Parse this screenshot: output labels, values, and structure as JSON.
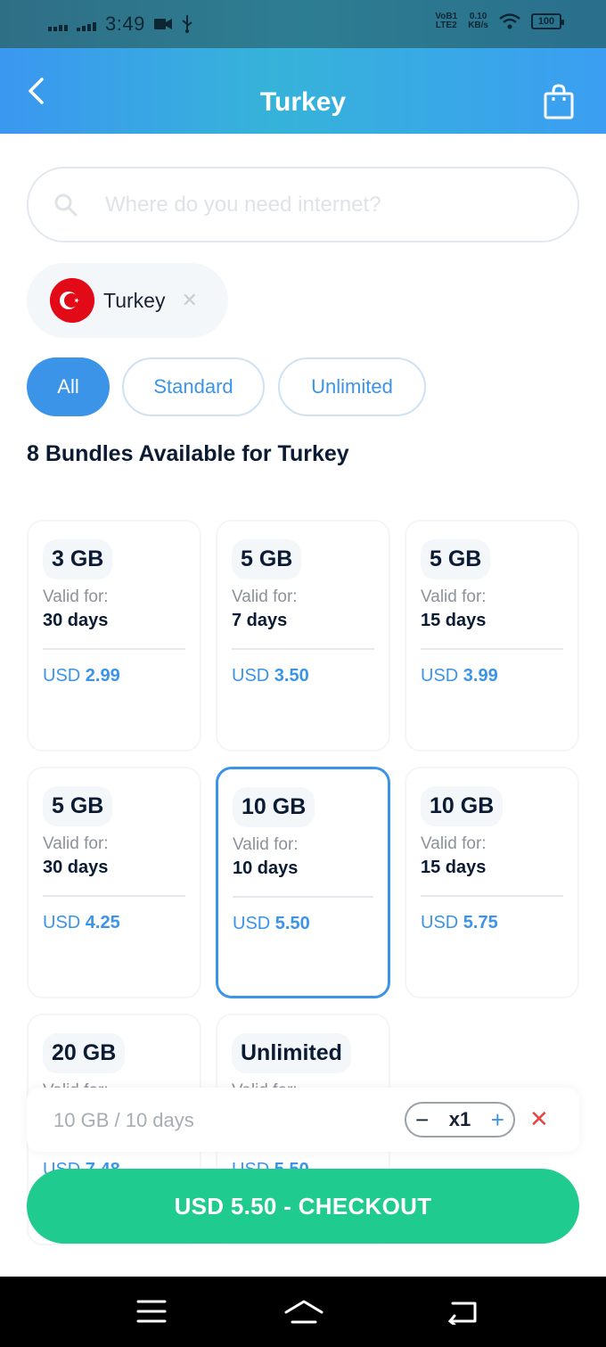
{
  "status_bar": {
    "time": "3:49",
    "network_type": "LTE2",
    "volte": "VoB1",
    "speed_value": "0.10",
    "speed_unit": "KB/s",
    "battery": "100"
  },
  "header": {
    "title": "Turkey"
  },
  "search": {
    "placeholder": "Where do you need internet?"
  },
  "chip": {
    "label": "Turkey"
  },
  "filters": [
    {
      "label": "All"
    },
    {
      "label": "Standard"
    },
    {
      "label": "Unlimited"
    }
  ],
  "heading": "8 Bundles Available for Turkey",
  "bundles": [
    {
      "data": "3 GB",
      "valid_label": "Valid for:",
      "days": "30 days",
      "currency": "USD",
      "price": "2.99"
    },
    {
      "data": "5 GB",
      "valid_label": "Valid for:",
      "days": "7 days",
      "currency": "USD",
      "price": "3.50"
    },
    {
      "data": "5 GB",
      "valid_label": "Valid for:",
      "days": "15 days",
      "currency": "USD",
      "price": "3.99"
    },
    {
      "data": "5 GB",
      "valid_label": "Valid for:",
      "days": "30 days",
      "currency": "USD",
      "price": "4.25"
    },
    {
      "data": "10 GB",
      "valid_label": "Valid for:",
      "days": "10 days",
      "currency": "USD",
      "price": "5.50"
    },
    {
      "data": "10 GB",
      "valid_label": "Valid for:",
      "days": "15 days",
      "currency": "USD",
      "price": "5.75"
    },
    {
      "data": "20 GB",
      "valid_label": "Valid for:",
      "days": "",
      "currency": "USD",
      "price": "7.48"
    },
    {
      "data": "Unlimited",
      "valid_label": "Valid for:",
      "days": "",
      "currency": "USD",
      "price": "5.50"
    }
  ],
  "selection": {
    "summary": "10 GB / 10 days",
    "quantity": "x1",
    "minus": "−",
    "plus": "+",
    "remove": "✕"
  },
  "checkout": {
    "label": "USD 5.50 - CHECKOUT"
  },
  "colors": {
    "accent": "#3b94e8",
    "checkout": "#1fcb8e",
    "remove": "#e64545"
  }
}
